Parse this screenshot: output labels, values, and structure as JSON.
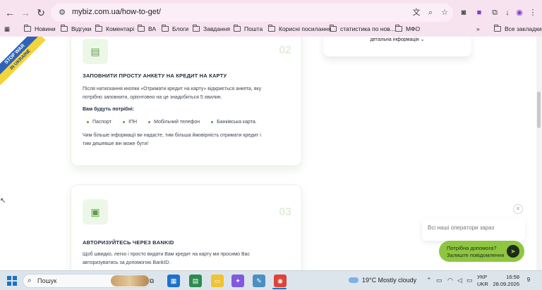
{
  "browser": {
    "url": "mybiz.com.ua/how-to-get/",
    "bookmarks": [
      "Новини",
      "Відгуки",
      "Коментарі",
      "ВА",
      "Блоги",
      "Завдання",
      "Пошта",
      "Корисні посилання",
      "статистика по нов...",
      "МФО"
    ],
    "all_bookmarks": "Все закладки",
    "overflow": "»"
  },
  "banner": {
    "line1": "STOP WAR",
    "line2": "IN UKRAINE"
  },
  "right_panel": {
    "detail_link": "детальна інформація"
  },
  "card1": {
    "number": "02",
    "title": "ЗАПОВНИТИ ПРОСТУ АНКЕТУ НА КРЕДИТ НА КАРТУ",
    "para1_line1": "Після натискання кнопки «Отримати кредит на карту» відкриється анкета, яку",
    "para1_line2": "потрібно заповнити, орієнтовно на це знадобиться 5 хвилин.",
    "needs_label": "Вам будуть потрібні:",
    "docs": [
      "Паспорт",
      "ІПН",
      "Мобільний телефон",
      "Банківська карта."
    ],
    "para2_line1": "Чим більше інформації ви надасте, тим більша ймовірність отримати кредит і",
    "para2_line2": "тим дешевше він може бути!"
  },
  "card2": {
    "number": "03",
    "title": "АВТОРИЗУЙТЕСЬ ЧЕРЕЗ BANKID",
    "para_line1": "Щоб швидко, легко і просто видати Вам кредит на карту ми просимо Вас",
    "para_line2": "авторизуватись за допомогою BankID."
  },
  "chat": {
    "operators_text": "Всі наші оператори зараз",
    "help_line1": "Потрібна допомога?",
    "help_line2": "Залиште повідомлення"
  },
  "taskbar": {
    "search": "Пошук",
    "weather": "19°C  Mostly cloudy",
    "lang_line1": "УКР",
    "lang_line2": "UKR",
    "time": "16:58",
    "date": "28.09.2026",
    "notifications": "9"
  }
}
